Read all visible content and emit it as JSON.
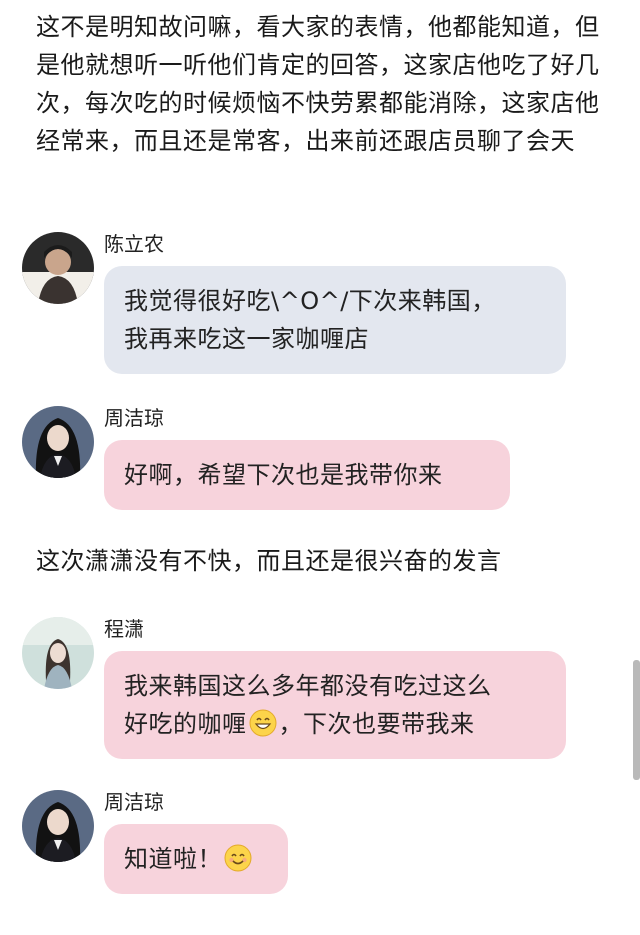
{
  "narration_1": "这不是明知故问嘛，看大家的表情，他都能知道，但是他就想听一听他们肯定的回答，这家店他吃了好几次，每次吃的时候烦恼不快劳累都能消除，这家店他经常来，而且还是常客，出来前还跟店员聊了会天",
  "narration_2": "这次潇潇没有不快，而且还是很兴奋的发言",
  "messages": [
    {
      "sender": "陈立农",
      "lines": [
        "我觉得很好吃\\^O^/下次来韩国，",
        "我再来吃这一家咖喱店"
      ],
      "color": "#e3e7ef"
    },
    {
      "sender": "周洁琼",
      "lines": [
        "好啊，希望下次也是我带你来"
      ],
      "color": "#f7d3dc"
    },
    {
      "sender": "程潇",
      "line1": "我来韩国这么多年都没有吃过这么",
      "line2_before_emoji": "好吃的咖喱",
      "line2_after_emoji": "，下次也要带我来",
      "emoji": "grinning-face-icon",
      "color": "#f7d3dc"
    },
    {
      "sender": "周洁琼",
      "text_before_emoji": "知道啦！",
      "emoji": "smiling-face-icon",
      "color": "#f7d3dc"
    }
  ]
}
